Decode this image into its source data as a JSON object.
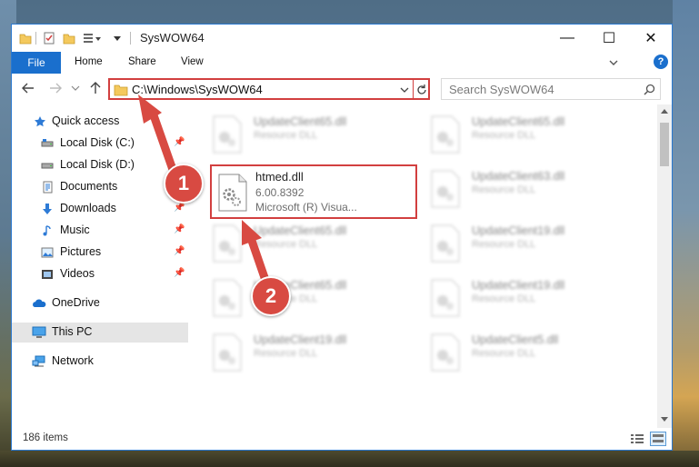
{
  "window": {
    "title": "SysWOW64",
    "controls": {
      "minimize": "—",
      "maximize": "☐",
      "close": "✕"
    }
  },
  "ribbon": {
    "tabs": [
      {
        "label": "File"
      },
      {
        "label": "Home"
      },
      {
        "label": "Share"
      },
      {
        "label": "View"
      }
    ],
    "help": "?"
  },
  "address": {
    "path": "C:\\Windows\\SysWOW64",
    "search_placeholder": "Search SysWOW64"
  },
  "nav": {
    "quick_access": "Quick access",
    "items": [
      {
        "label": "Local Disk (C:)",
        "icon": "drive-icon"
      },
      {
        "label": "Local Disk (D:)",
        "icon": "drive-icon"
      },
      {
        "label": "Documents",
        "icon": "documents-icon"
      },
      {
        "label": "Downloads",
        "icon": "download-icon"
      },
      {
        "label": "Music",
        "icon": "music-icon"
      },
      {
        "label": "Pictures",
        "icon": "pictures-icon"
      },
      {
        "label": "Videos",
        "icon": "videos-icon"
      }
    ],
    "onedrive": "OneDrive",
    "this_pc": "This PC",
    "network": "Network"
  },
  "files": {
    "left": [
      {
        "name": "UpdateClient65.dll",
        "desc": "Resource DLL"
      },
      {
        "name": "UpdateClient65.dll",
        "desc": "Resource DLL"
      },
      {
        "name": "UpdateClient65.dll",
        "desc": "Resource DLL"
      },
      {
        "name": "UpdateClient19.dll",
        "desc": "Resource DLL"
      }
    ],
    "right": [
      {
        "name": "UpdateClient65.dll",
        "desc": "Resource DLL"
      },
      {
        "name": "UpdateClient63.dll",
        "desc": "Resource DLL"
      },
      {
        "name": "UpdateClient19.dll",
        "desc": "Resource DLL"
      },
      {
        "name": "UpdateClient19.dll",
        "desc": "Resource DLL"
      },
      {
        "name": "UpdateClient5.dll",
        "desc": "Resource DLL"
      }
    ],
    "highlighted": {
      "name": "htmed.dll",
      "version": "6.00.8392",
      "company": "Microsoft (R) Visua..."
    }
  },
  "status": {
    "items_count": "186 items"
  },
  "callouts": {
    "step1": "1",
    "step2": "2"
  },
  "colors": {
    "accent": "#1a6fcd",
    "callout": "#d84a42",
    "highlight_border": "#d23f3f"
  }
}
